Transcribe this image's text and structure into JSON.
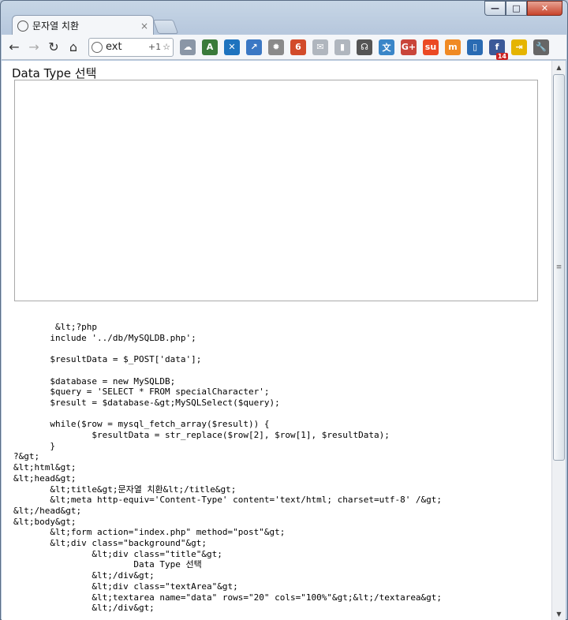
{
  "window": {
    "controls": {
      "minimize": "—",
      "maximize": "□",
      "close": "✕"
    }
  },
  "tab": {
    "title": "문자열 치환",
    "close": "×"
  },
  "toolbar": {
    "back": "←",
    "forward": "→",
    "reload": "↻",
    "home": "⌂",
    "omnibox_text": "ext",
    "omnibox_extra": "+1",
    "star": "☆",
    "extensions": [
      {
        "name": "cloud-icon",
        "glyph": "☁",
        "color": "#8a96a6"
      },
      {
        "name": "translate-icon",
        "glyph": "A",
        "color": "#3a7a3a"
      },
      {
        "name": "bowtie-icon",
        "glyph": "✕",
        "color": "#1e73be"
      },
      {
        "name": "shortcut-icon",
        "glyph": "↗",
        "color": "#3b78c4"
      },
      {
        "name": "gear-icon",
        "glyph": "✹",
        "color": "#8a8a8a"
      },
      {
        "name": "six-icon",
        "glyph": "6",
        "color": "#d24b2a"
      },
      {
        "name": "mail-icon",
        "glyph": "✉",
        "color": "#b0b6be"
      },
      {
        "name": "stats-icon",
        "glyph": "▮",
        "color": "#b0b6be"
      },
      {
        "name": "headphones-icon",
        "glyph": "☊",
        "color": "#555"
      },
      {
        "name": "translate2-icon",
        "glyph": "文",
        "color": "#3a86c8"
      },
      {
        "name": "gplus-icon",
        "glyph": "G+",
        "color": "#c9453a"
      },
      {
        "name": "stumbleupon-icon",
        "glyph": "su",
        "color": "#eb4924"
      },
      {
        "name": "m-icon",
        "glyph": "m",
        "color": "#f08a24"
      },
      {
        "name": "phone-send-icon",
        "glyph": "▯",
        "color": "#2a6bb3"
      },
      {
        "name": "facebook-icon",
        "glyph": "f",
        "color": "#3b5998",
        "badge": "14"
      },
      {
        "name": "phone-arrow-icon",
        "glyph": "⇥",
        "color": "#e5b400"
      },
      {
        "name": "wrench-icon",
        "glyph": "🔧",
        "color": "#666"
      }
    ]
  },
  "page": {
    "heading": "Data Type 선택",
    "textarea_value": "",
    "code_lines": [
      "        &lt;?php",
      "       include '../db/MySQLDB.php';",
      "",
      "       $resultData = $_POST['data'];",
      "",
      "       $database = new MySQLDB;",
      "       $query = 'SELECT * FROM specialCharacter';",
      "       $result = $database-&gt;MySQLSelect($query);",
      "",
      "       while($row = mysql_fetch_array($result)) {",
      "               $resultData = str_replace($row[2], $row[1], $resultData);",
      "       }",
      "?&gt;",
      "&lt;html&gt;",
      "&lt;head&gt;",
      "       &lt;title&gt;문자열 치환&lt;/title&gt;",
      "       &lt;meta http-equiv='Content-Type' content='text/html; charset=utf-8' /&gt;",
      "&lt;/head&gt;",
      "&lt;body&gt;",
      "       &lt;form action=\"index.php\" method=\"post\"&gt;",
      "       &lt;div class=\"background\"&gt;",
      "               &lt;div class=\"title\"&gt;",
      "                       Data Type 선택",
      "               &lt;/div&gt;",
      "               &lt;div class=\"textArea\"&gt;",
      "               &lt;textarea name=\"data\" rows=\"20\" cols=\"100%\"&gt;&lt;/textarea&gt;",
      "               &lt;/div&gt;"
    ]
  },
  "scrollbar": {
    "up": "▲",
    "down": "▼",
    "grip": "≡"
  }
}
